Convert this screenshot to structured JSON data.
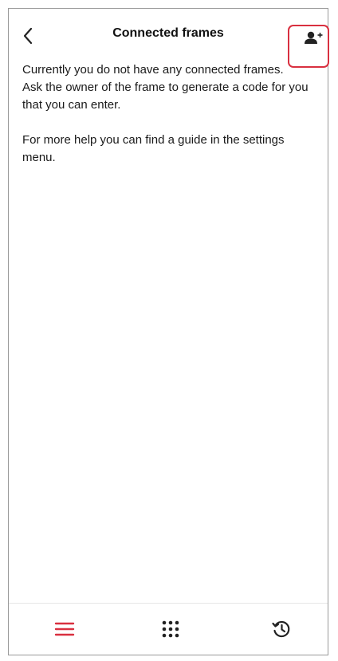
{
  "header": {
    "title": "Connected frames",
    "back_icon": "chevron-left-icon",
    "add_icon": "add-person-icon"
  },
  "content": {
    "line1": "Currently you do not have any connected frames.",
    "line2": "Ask the owner of the frame to generate a code for you that you can enter.",
    "line3": "For more help you can find a guide in the settings menu."
  },
  "tabs": [
    {
      "icon": "menu-icon",
      "active": true
    },
    {
      "icon": "grid-icon",
      "active": false
    },
    {
      "icon": "history-icon",
      "active": false
    }
  ],
  "colors": {
    "accent": "#d93040",
    "text": "#1a1a1a",
    "icon": "#222222"
  }
}
